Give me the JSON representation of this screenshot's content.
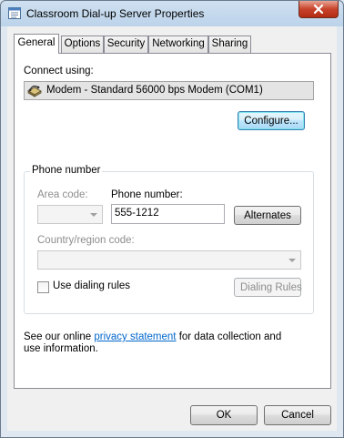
{
  "window": {
    "title": "Classroom Dial-up Server Properties"
  },
  "tabs": [
    {
      "label": "General",
      "active": true
    },
    {
      "label": "Options",
      "active": false
    },
    {
      "label": "Security",
      "active": false
    },
    {
      "label": "Networking",
      "active": false
    },
    {
      "label": "Sharing",
      "active": false
    }
  ],
  "general": {
    "connect_using_label": "Connect using:",
    "device_name": "Modem - Standard 56000 bps Modem (COM1)",
    "configure_label": "Configure...",
    "phone_group_title": "Phone number",
    "area_code_label": "Area code:",
    "area_code_value": "",
    "phone_number_label": "Phone number:",
    "phone_number_value": "555-1212",
    "alternates_label": "Alternates",
    "country_label": "Country/region code:",
    "country_value": "",
    "dialing_rules_checkbox_label": "Use dialing rules",
    "dialing_rules_checked": false,
    "dialing_rules_button_label": "Dialing Rules",
    "info_prefix": "See our online ",
    "info_link": "privacy statement",
    "info_suffix": " for data collection and use information."
  },
  "footer": {
    "ok_label": "OK",
    "cancel_label": "Cancel"
  },
  "colors": {
    "link": "#0066cc",
    "focus_button": "#bee6fd",
    "close_button": "#c7432b"
  }
}
